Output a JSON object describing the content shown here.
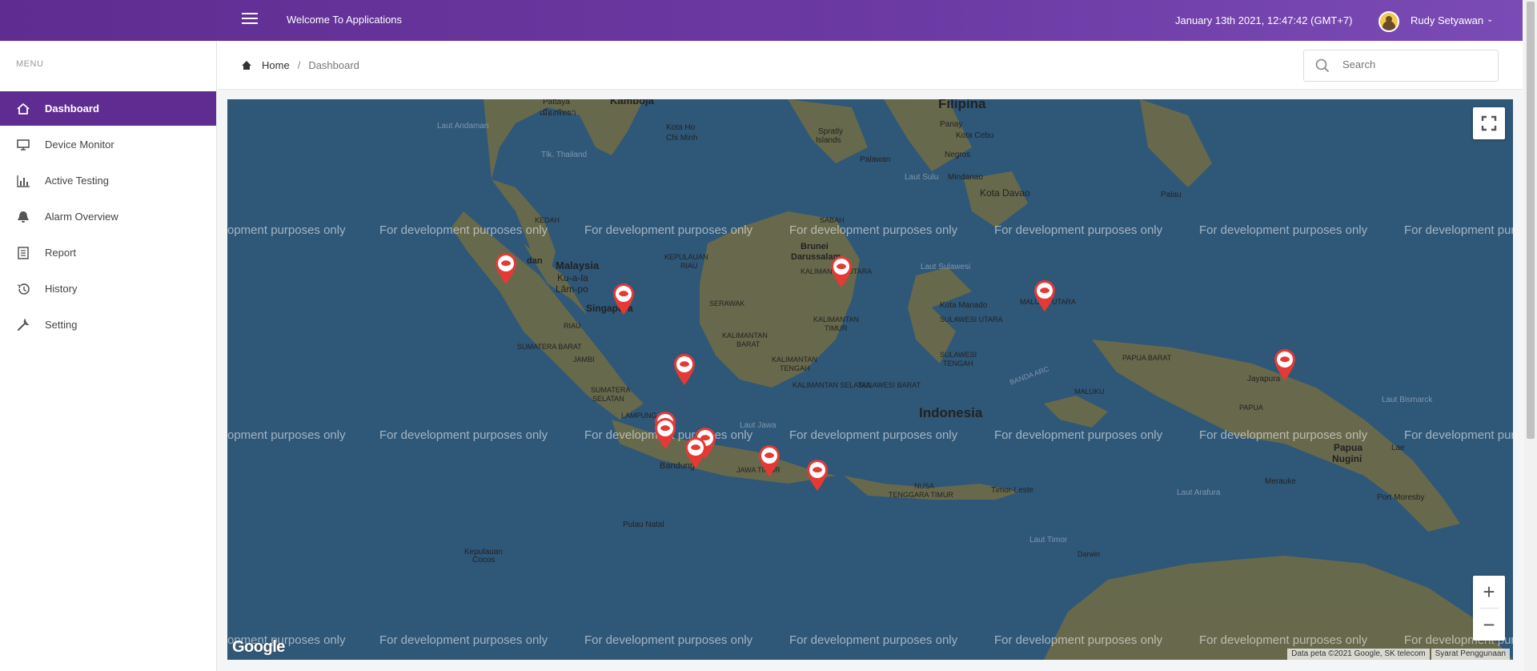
{
  "header": {
    "app_title": "Welcome To Applications",
    "datetime": "January 13th 2021, 12:47:42 (GMT+7)",
    "user_name": "Rudy Setyawan"
  },
  "sidebar": {
    "menu_label": "MENU",
    "items": [
      {
        "label": "Dashboard",
        "icon": "home-icon",
        "active": true
      },
      {
        "label": "Device Monitor",
        "icon": "monitor-icon"
      },
      {
        "label": "Active Testing",
        "icon": "bar-chart-icon"
      },
      {
        "label": "Alarm Overview",
        "icon": "bell-icon"
      },
      {
        "label": "Report",
        "icon": "document-icon"
      },
      {
        "label": "History",
        "icon": "history-icon"
      },
      {
        "label": "Setting",
        "icon": "wrench-icon"
      }
    ]
  },
  "breadcrumb": {
    "home": "Home",
    "separator": "/",
    "current": "Dashboard"
  },
  "search": {
    "placeholder": "Search",
    "value": ""
  },
  "map": {
    "watermark": "For development purposes only",
    "watermark_partial_left": "opment purposes only",
    "watermark_partial_right": "For development pur",
    "places": {
      "kamboja": "Kamboja",
      "filipina": "Filipina",
      "pattaya": "Pattaya",
      "pattaya_thai": "เมืองพัทยา",
      "laut_andaman": "Laut Andaman",
      "kota_ho_chi_minh_1": "Kota Ho",
      "kota_ho_chi_minh_2": "Chi Minh",
      "spratly_1": "Spratly",
      "spratly_2": "Islands",
      "panay": "Panay",
      "kota_cebu": "Kota Cebu",
      "negros": "Negros",
      "palawan": "Palawan",
      "tlk_thailand": "Tlk. Thailand",
      "laut_sulu": "Laut Sulu",
      "mindanao": "Mindanao",
      "kota_davao": "Kota Davao",
      "palau": "Palau",
      "kedah": "KEDAH",
      "sabah": "SABAH",
      "brunei_1": "Brunei",
      "brunei_2": "Darussalam",
      "medan": "dan",
      "malaysia": "Malaysia",
      "kuala_1": "Ku-a-la",
      "kuala_2": "Lâm-po",
      "kepulauan_riau_1": "KEPULAUAN",
      "kepulauan_riau_2": "RIAU",
      "kalimantan_utara": "KALIMANTAN UTARA",
      "laut_sulawesi": "Laut Sulawesi",
      "singapura": "Singapura",
      "serawak": "SERAWAK",
      "kota_manado": "Kota Manado",
      "maluku_utara": "MALUKU UTARA",
      "sulawesi_utara": "SULAWESI UTARA",
      "riau": "RIAU",
      "kalimantan_timur_1": "KALIMANTAN",
      "kalimantan_timur_2": "TIMUR",
      "kalimantan_barat_1": "KALIMANTAN",
      "kalimantan_barat_2": "BARAT",
      "sumatera_barat": "SUMATERA BARAT",
      "jambi": "JAMBI",
      "kalimantan_tengah_1": "KALIMANTAN",
      "kalimantan_tengah_2": "TENGAH",
      "sulawesi_tengah_1": "SULAWESI",
      "sulawesi_tengah_2": "TENGAH",
      "papua_barat": "PAPUA BARAT",
      "banda_arc": "BANDA ARC",
      "kalimantan_selatan": "KALIMANTAN SELATAN",
      "sulawesi_barat": "SULAWESI BARAT",
      "sumatera_selatan_1": "SUMATERA",
      "sumatera_selatan_2": "SELATAN",
      "maluku": "MALUKU",
      "jayapura": "Jayapura",
      "laut_bismarck": "Laut Bismarck",
      "papua": "PAPUA",
      "lampung": "LAMPUNG",
      "laut_jawa": "Laut Jawa",
      "indonesia": "Indonesia",
      "papua_nugini_1": "Papua",
      "papua_nugini_2": "Nugini",
      "lae": "Lae",
      "bandung": "Bandung",
      "jawa_timur": "JAWA TIMUR",
      "merauke": "Merauke",
      "nusa_tenggara_1": "NUSA",
      "nusa_tenggara_2": "TENGGARA TIMUR",
      "timor_leste": "Timor-Leste",
      "laut_arafura": "Laut Arafura",
      "port_moresby": "Port Moresby",
      "pulau_natal": "Pulau Natal",
      "laut_timor": "Laut Timor",
      "kepulauan_cocos_1": "Kepulauan",
      "kepulauan_cocos_2": "Cocos",
      "darwin": "Darwin"
    },
    "google_logo": "Google",
    "attribution": "Data peta ©2021 Google, SK telecom",
    "terms": "Syarat Penggunaan",
    "zoom_in": "+",
    "zoom_out": "−",
    "colors": {
      "sea": "#2f5778",
      "land": "#6b6a4a",
      "pin": "#e53935"
    }
  }
}
